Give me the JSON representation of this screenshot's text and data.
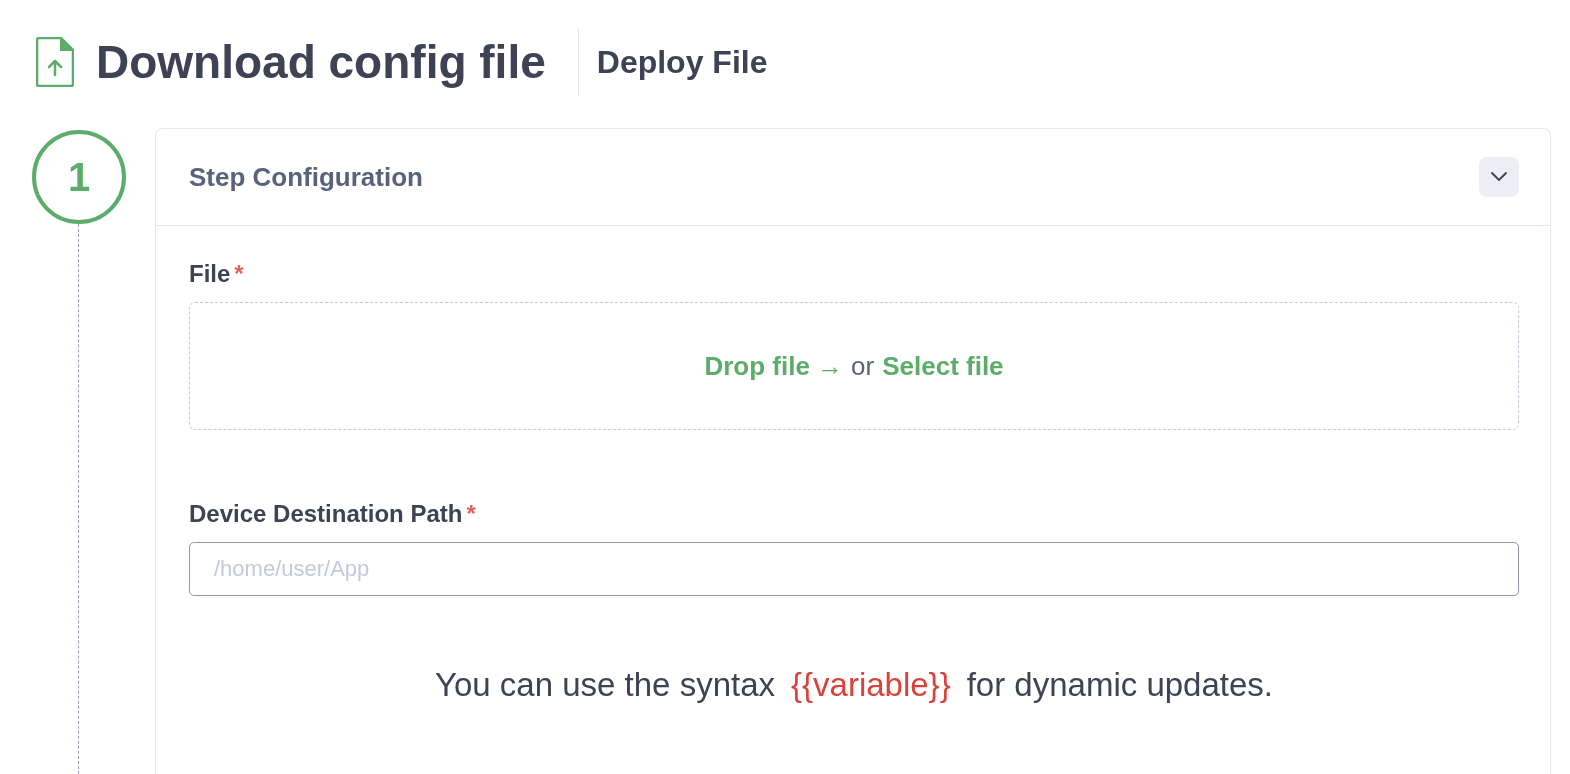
{
  "header": {
    "title": "Download config file",
    "subtitle": "Deploy File"
  },
  "step": {
    "number": "1",
    "card_title": "Step Configuration",
    "expanded": true
  },
  "fields": [
    {
      "kind": "dropzone",
      "label": "File",
      "required": true,
      "required_mark": "*",
      "drop_link": "Drop file →",
      "or_text": "or",
      "select_link": "Select file"
    },
    {
      "kind": "text",
      "label": "Device Destination Path",
      "required": true,
      "required_mark": "*",
      "placeholder": "/home/user/App"
    }
  ],
  "hint": {
    "before": "You can use the syntax",
    "code": "{{variable}}",
    "after": "for dynamic updates."
  }
}
